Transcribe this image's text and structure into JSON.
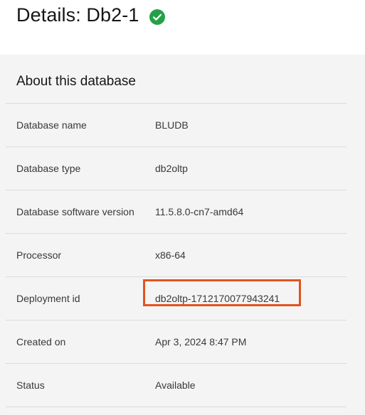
{
  "header": {
    "title": "Details: Db2-1",
    "status_icon": "checkmark-circle-icon",
    "status_color": "#24a148"
  },
  "about": {
    "section_title": "About this database",
    "rows": [
      {
        "label": "Database name",
        "value": "BLUDB"
      },
      {
        "label": "Database type",
        "value": "db2oltp"
      },
      {
        "label": "Database software version",
        "value": "11.5.8.0-cn7-amd64"
      },
      {
        "label": "Processor",
        "value": "x86-64"
      },
      {
        "label": "Deployment id",
        "value": "db2oltp-1712170077943241"
      },
      {
        "label": "Created on",
        "value": "Apr 3, 2024 8:47 PM"
      },
      {
        "label": "Status",
        "value": "Available"
      }
    ]
  },
  "colors": {
    "panel_background": "#f4f4f4",
    "highlight": "#e2531f"
  }
}
